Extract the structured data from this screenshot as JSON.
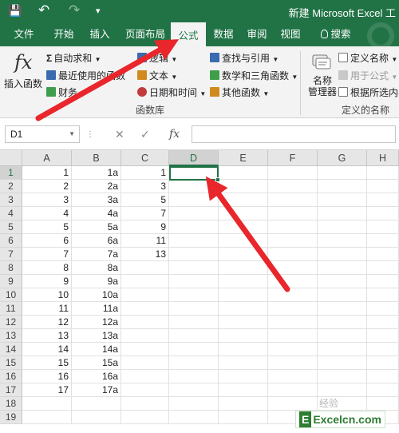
{
  "titlebar": {
    "title": "新建 Microsoft Excel 工",
    "save_glyph": "💾",
    "undo_glyph": "↶",
    "redo_glyph": "↷",
    "more_glyph": "▾"
  },
  "tabs": [
    "文件",
    "开始",
    "插入",
    "页面布局",
    "公式",
    "数据",
    "审阅",
    "视图",
    "搜索"
  ],
  "active_tab": "公式",
  "ribbon": {
    "insert_function": "插入函数",
    "fx": "fx",
    "autosum": "自动求和",
    "recent": "最近使用的函数",
    "finance": "财务",
    "logic": "逻辑",
    "text": "文本",
    "datetime": "日期和时间",
    "lookup": "查找与引用",
    "math": "数学和三角函数",
    "other": "其他函数",
    "group_function_library": "函数库",
    "name_manager_1": "名称",
    "name_manager_2": "管理器",
    "define_name": "定义名称",
    "use_in_formula": "用于公式",
    "create_from_selection": "根据所选内容",
    "group_defined_names": "定义的名称"
  },
  "formula_bar": {
    "name_box": "D1",
    "cancel": "✕",
    "enter": "✓",
    "fx": "fx",
    "value": ""
  },
  "sheet": {
    "columns": [
      "A",
      "B",
      "C",
      "D",
      "E",
      "F",
      "G",
      "H"
    ],
    "selected_column": "D",
    "selected_row": "1",
    "active_cell": "D1",
    "rows": [
      {
        "n": "1",
        "A": "1",
        "B": "1a",
        "C": "1"
      },
      {
        "n": "2",
        "A": "2",
        "B": "2a",
        "C": "3"
      },
      {
        "n": "3",
        "A": "3",
        "B": "3a",
        "C": "5"
      },
      {
        "n": "4",
        "A": "4",
        "B": "4a",
        "C": "7"
      },
      {
        "n": "5",
        "A": "5",
        "B": "5a",
        "C": "9"
      },
      {
        "n": "6",
        "A": "6",
        "B": "6a",
        "C": "11"
      },
      {
        "n": "7",
        "A": "7",
        "B": "7a",
        "C": "13"
      },
      {
        "n": "8",
        "A": "8",
        "B": "8a",
        "C": ""
      },
      {
        "n": "9",
        "A": "9",
        "B": "9a",
        "C": ""
      },
      {
        "n": "10",
        "A": "10",
        "B": "10a",
        "C": ""
      },
      {
        "n": "11",
        "A": "11",
        "B": "11a",
        "C": ""
      },
      {
        "n": "12",
        "A": "12",
        "B": "12a",
        "C": ""
      },
      {
        "n": "13",
        "A": "13",
        "B": "13a",
        "C": ""
      },
      {
        "n": "14",
        "A": "14",
        "B": "14a",
        "C": ""
      },
      {
        "n": "15",
        "A": "15",
        "B": "15a",
        "C": ""
      },
      {
        "n": "16",
        "A": "16",
        "B": "16a",
        "C": ""
      },
      {
        "n": "17",
        "A": "17",
        "B": "17a",
        "C": ""
      },
      {
        "n": "18",
        "A": "",
        "B": "",
        "C": ""
      },
      {
        "n": "19",
        "A": "",
        "B": "",
        "C": ""
      }
    ]
  },
  "watermark": {
    "logo": "E",
    "text": "Excelcn.com",
    "faint": "经验"
  },
  "colors": {
    "excel_green": "#217346",
    "arrow_red": "#e8262b"
  }
}
